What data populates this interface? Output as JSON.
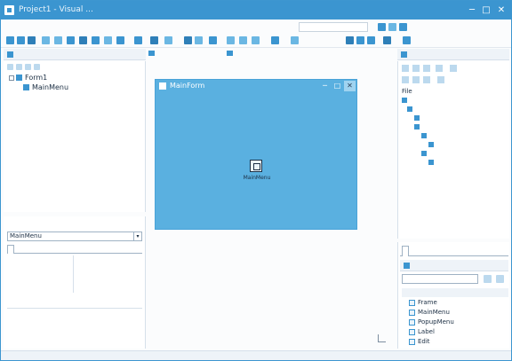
{
  "window": {
    "title": "Project1 - Visual ...",
    "min_label": "─",
    "max_label": "□",
    "close_label": "✕"
  },
  "menu": [
    "",
    "",
    "",
    "",
    "",
    "",
    "",
    "",
    "",
    "",
    "",
    "",
    ""
  ],
  "search": {
    "placeholder": ""
  },
  "panels": {
    "structure": {
      "title": ""
    },
    "designer_tabs": [
      "",
      "",
      ""
    ],
    "object_inspector": {
      "title": ""
    },
    "project_manager": {
      "title": ""
    },
    "toolbox": {
      "tabs": [
        "",
        "",
        ""
      ],
      "title": ""
    }
  },
  "tree": {
    "root": "Form1",
    "child": "MainMenu"
  },
  "object_inspector": {
    "selected": "MainMenu",
    "tabs": [
      "",
      ""
    ],
    "properties": [
      {
        "name": "",
        "value": ""
      },
      {
        "name": "",
        "value": ""
      },
      {
        "name": "",
        "value": ""
      },
      {
        "name": "",
        "value": ""
      },
      {
        "name": "",
        "value": ""
      }
    ],
    "description_head": "",
    "description_title": ""
  },
  "form": {
    "title": "MainForm",
    "component_label": "MainMenu"
  },
  "project_tree": [
    "File",
    "",
    "",
    "",
    "",
    "",
    "",
    "",
    ""
  ],
  "toolbox": {
    "category": "",
    "items": [
      "Frame",
      "MainMenu",
      "PopupMenu",
      "Label",
      "Edit"
    ]
  },
  "status": [
    "",
    "",
    "",
    "",
    "",
    "",
    "",
    ""
  ]
}
